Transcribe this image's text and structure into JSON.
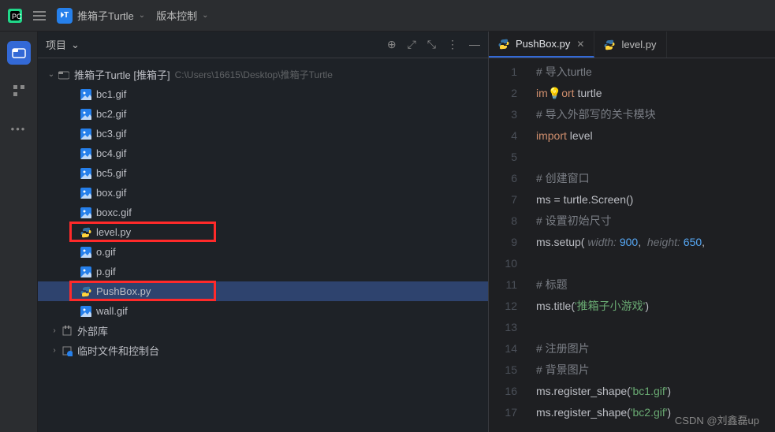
{
  "topbar": {
    "project_badge": "🞂T",
    "project_name": "推箱子Turtle",
    "vcs_label": "版本控制"
  },
  "project_panel": {
    "title": "项目"
  },
  "tree": {
    "root_label": "推箱子Turtle [推箱子]",
    "root_path": "C:\\Users\\16615\\Desktop\\推箱子Turtle",
    "files": [
      {
        "name": "bc1.gif",
        "type": "img"
      },
      {
        "name": "bc2.gif",
        "type": "img"
      },
      {
        "name": "bc3.gif",
        "type": "img"
      },
      {
        "name": "bc4.gif",
        "type": "img"
      },
      {
        "name": "bc5.gif",
        "type": "img"
      },
      {
        "name": "box.gif",
        "type": "img"
      },
      {
        "name": "boxc.gif",
        "type": "img"
      },
      {
        "name": "level.py",
        "type": "py",
        "boxed": true
      },
      {
        "name": "o.gif",
        "type": "img"
      },
      {
        "name": "p.gif",
        "type": "img"
      },
      {
        "name": "PushBox.py",
        "type": "py",
        "selected": true,
        "boxed": true
      },
      {
        "name": "wall.gif",
        "type": "img"
      }
    ],
    "extlib": "外部库",
    "scratch": "临时文件和控制台"
  },
  "tabs": [
    {
      "name": "PushBox.py",
      "active": true
    },
    {
      "name": "level.py",
      "active": false
    }
  ],
  "code_lines": [
    {
      "n": 1,
      "tokens": [
        {
          "t": "# 导入turtle",
          "c": "com"
        }
      ]
    },
    {
      "n": 2,
      "tokens": [
        {
          "t": "im",
          "c": "kw"
        },
        {
          "t": "💡",
          "c": "bulb"
        },
        {
          "t": "ort",
          "c": "kw"
        },
        {
          "t": " turtle",
          "c": "id"
        }
      ]
    },
    {
      "n": 3,
      "tokens": [
        {
          "t": "# 导入外部写的关卡模块",
          "c": "com"
        }
      ]
    },
    {
      "n": 4,
      "tokens": [
        {
          "t": "import",
          "c": "kw"
        },
        {
          "t": " level",
          "c": "id"
        }
      ]
    },
    {
      "n": 5,
      "tokens": []
    },
    {
      "n": 6,
      "tokens": [
        {
          "t": "# 创建窗口",
          "c": "com"
        }
      ]
    },
    {
      "n": 7,
      "tokens": [
        {
          "t": "ms = turtle.Screen()",
          "c": "id"
        }
      ]
    },
    {
      "n": 8,
      "tokens": [
        {
          "t": "# 设置初始尺寸",
          "c": "com"
        }
      ]
    },
    {
      "n": 9,
      "tokens": [
        {
          "t": "ms.setup(",
          "c": "id"
        },
        {
          "t": " width: ",
          "c": "hint"
        },
        {
          "t": "900",
          "c": "num"
        },
        {
          "t": ",",
          "c": "id"
        },
        {
          "t": "  height: ",
          "c": "hint"
        },
        {
          "t": "650",
          "c": "num"
        },
        {
          "t": ",",
          "c": "id"
        }
      ]
    },
    {
      "n": 10,
      "tokens": []
    },
    {
      "n": 11,
      "tokens": [
        {
          "t": "# 标题",
          "c": "com"
        }
      ]
    },
    {
      "n": 12,
      "tokens": [
        {
          "t": "ms.title(",
          "c": "id"
        },
        {
          "t": "'推箱子小游戏'",
          "c": "str"
        },
        {
          "t": ")",
          "c": "id"
        }
      ]
    },
    {
      "n": 13,
      "tokens": []
    },
    {
      "n": 14,
      "tokens": [
        {
          "t": "# 注册图片",
          "c": "com"
        }
      ]
    },
    {
      "n": 15,
      "tokens": [
        {
          "t": "# 背景图片",
          "c": "com"
        }
      ]
    },
    {
      "n": 16,
      "tokens": [
        {
          "t": "ms.register_shape(",
          "c": "id"
        },
        {
          "t": "'bc1.gif'",
          "c": "str"
        },
        {
          "t": ")",
          "c": "id"
        }
      ]
    },
    {
      "n": 17,
      "tokens": [
        {
          "t": "ms.register_shape(",
          "c": "id"
        },
        {
          "t": "'bc2.gif'",
          "c": "str"
        },
        {
          "t": ")",
          "c": "id"
        }
      ]
    }
  ],
  "watermark": "CSDN @刘鑫磊up"
}
